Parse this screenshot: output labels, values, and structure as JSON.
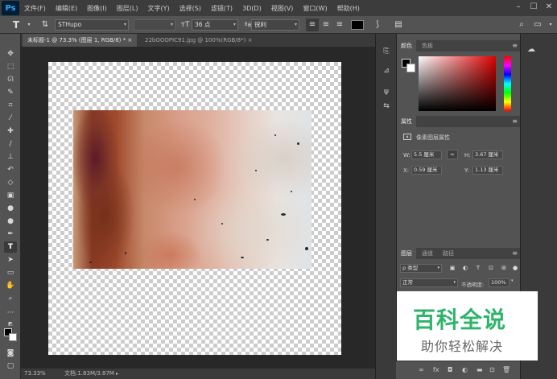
{
  "app": {
    "logo": "Ps"
  },
  "menu": {
    "items": [
      "文件(F)",
      "编辑(E)",
      "图像(I)",
      "图层(L)",
      "文字(Y)",
      "选择(S)",
      "滤镜(T)",
      "3D(D)",
      "视图(V)",
      "窗口(W)",
      "帮助(H)"
    ]
  },
  "options": {
    "tool_icon": "T",
    "font_family": "STHupo",
    "font_size": "36 点",
    "antialias": "锐利",
    "text_color": "#000000"
  },
  "tabs": [
    {
      "label": "未标题-1 @ 73.3% (图层 1, RGB/8) *",
      "close": "×"
    },
    {
      "label": "22bOOOPIC91.jpg @ 100%(RGB/8*)",
      "close": "×"
    }
  ],
  "status": {
    "zoom": "73.33%",
    "doc": "文档:1.83M/3.87M"
  },
  "color_panel": {
    "tabs": [
      "颜色",
      "色板"
    ]
  },
  "properties_panel": {
    "tabs": [
      "属性"
    ],
    "title": "像素图层属性",
    "w_label": "W:",
    "w_value": "5.5 厘米",
    "h_label": "H:",
    "h_value": "3.67 厘米",
    "x_label": "X:",
    "x_value": "0.59 厘米",
    "y_label": "Y:",
    "y_value": "1.13 厘米"
  },
  "layers_panel": {
    "tabs": [
      "图层",
      "通道",
      "路径"
    ],
    "filter": "ρ 类型",
    "blend_mode": "正常",
    "opacity_label": "不透明度:",
    "opacity_value": "100%"
  },
  "watermark": {
    "title": "百科全说",
    "subtitle": "助你轻松解决"
  }
}
